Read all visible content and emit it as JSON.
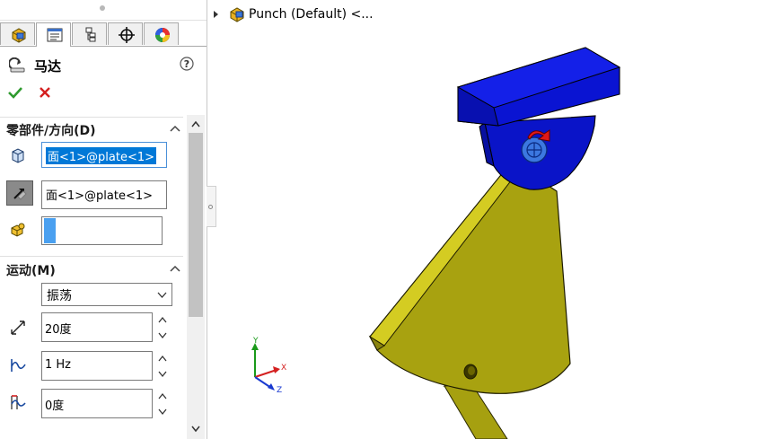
{
  "tabs": [
    {
      "name": "feature-manager",
      "icon": "feature-manager-icon"
    },
    {
      "name": "property-manager",
      "icon": "property-manager-icon",
      "active": true
    },
    {
      "name": "configuration-manager",
      "icon": "configuration-manager-icon"
    },
    {
      "name": "dimxpert-manager",
      "icon": "crosshair-icon"
    },
    {
      "name": "display-manager",
      "icon": "appearance-icon"
    }
  ],
  "property_manager": {
    "title": "马达",
    "help_symbol": "?",
    "ok_icon": "checkmark-icon",
    "cancel_icon": "cross-icon"
  },
  "component_direction": {
    "title": "零部件/方向",
    "shortcut": "(D)",
    "location_value": "面<1>@plate<1>",
    "direction_value": "面<1>@plate<1>",
    "component_value": ""
  },
  "motion": {
    "title": "运动",
    "shortcut": "(M)",
    "type_selected": "振荡",
    "displacement": "20度",
    "frequency": "1 Hz",
    "phase": "0度"
  },
  "graphics": {
    "tree_node_label": "Punch (Default) <...",
    "triad": {
      "x": "X",
      "y": "Y",
      "z": "Z"
    }
  },
  "colors": {
    "accent_blue": "#0078d7",
    "ok_green": "#2e9a2e",
    "cancel_red": "#d42020",
    "part_blue": "#0a14d2",
    "part_olive": "#b0aa10"
  }
}
